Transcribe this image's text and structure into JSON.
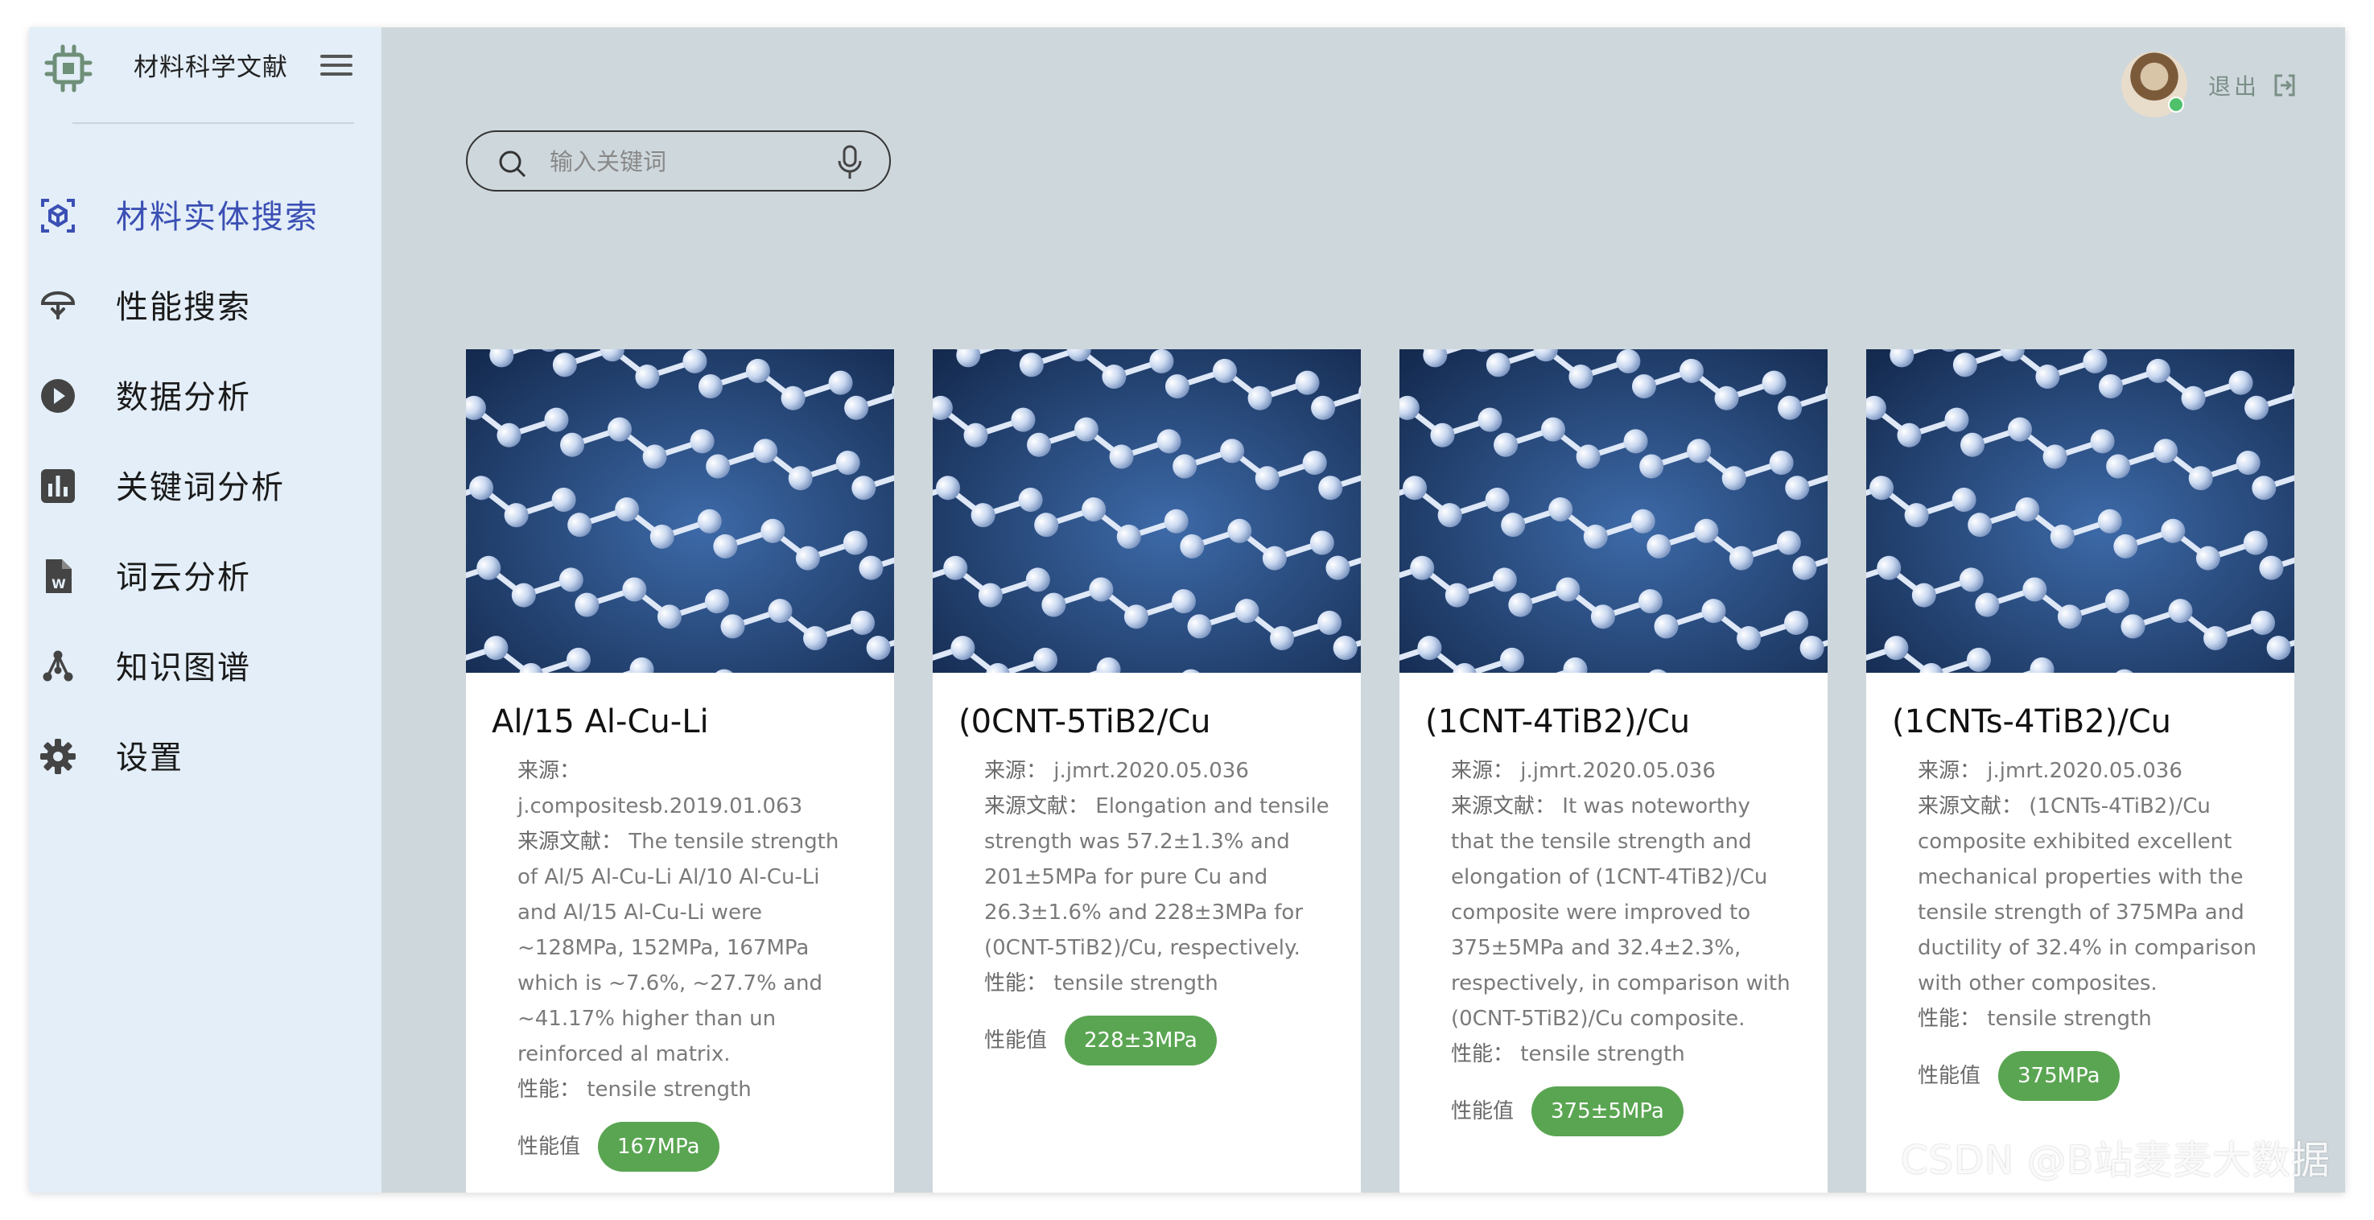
{
  "app": {
    "title": "材料科学文献"
  },
  "nav": {
    "items": [
      {
        "label": "材料实体搜索",
        "icon": "entity-search-icon",
        "active": true
      },
      {
        "label": "性能搜索",
        "icon": "performance-icon",
        "active": false
      },
      {
        "label": "数据分析",
        "icon": "play-circle-icon",
        "active": false
      },
      {
        "label": "关键词分析",
        "icon": "bar-chart-icon",
        "active": false
      },
      {
        "label": "词云分析",
        "icon": "word-file-icon",
        "active": false
      },
      {
        "label": "知识图谱",
        "icon": "graph-icon",
        "active": false
      },
      {
        "label": "设置",
        "icon": "gear-icon",
        "active": false
      }
    ]
  },
  "header": {
    "logout_label": "退出"
  },
  "search": {
    "placeholder": "输入关键词",
    "value": ""
  },
  "cards": [
    {
      "title": "Al/15 Al-Cu-Li",
      "source_key": "来源：",
      "source": "j.compositesb.2019.01.063",
      "doc_key": "来源文献：",
      "doc": "The tensile strength of Al/5 Al-Cu-Li Al/10 Al-Cu-Li and Al/15 Al-Cu-Li were ~128MPa, 152MPa, 167MPa which is ~7.6%, ~27.7% and ~41.17% higher than un reinforced al matrix.",
      "prop_key": "性能：",
      "prop": "tensile strength",
      "value_key": "性能值",
      "value": "167MPa"
    },
    {
      "title": "(0CNT-5TiB2/Cu",
      "source_key": "来源：",
      "source": "j.jmrt.2020.05.036",
      "doc_key": "来源文献：",
      "doc": "Elongation and tensile strength was 57.2±1.3% and 201±5MPa for pure Cu and 26.3±1.6% and 228±3MPa for (0CNT-5TiB2)/Cu, respectively.",
      "prop_key": "性能：",
      "prop": "tensile strength",
      "value_key": "性能值",
      "value": "228±3MPa"
    },
    {
      "title": "(1CNT-4TiB2)/Cu",
      "source_key": "来源：",
      "source": "j.jmrt.2020.05.036",
      "doc_key": "来源文献：",
      "doc": "It was noteworthy that the tensile strength and elongation of (1CNT-4TiB2)/Cu composite were improved to 375±5MPa and 32.4±2.3%, respectively, in comparison with (0CNT-5TiB2)/Cu composite.",
      "prop_key": "性能：",
      "prop": "tensile strength",
      "value_key": "性能值",
      "value": "375±5MPa"
    },
    {
      "title": "(1CNTs-4TiB2)/Cu",
      "source_key": "来源：",
      "source": "j.jmrt.2020.05.036",
      "doc_key": "来源文献：",
      "doc": "(1CNTs-4TiB2)/Cu composite exhibited excellent mechanical properties with the tensile strength of 375MPa and ductility of 32.4% in comparison with other composites.",
      "prop_key": "性能：",
      "prop": "tensile strength",
      "value_key": "性能值",
      "value": "375MPa"
    }
  ],
  "watermark": "CSDN @B站麦麦大数据",
  "colors": {
    "sidebar_bg": "#e3eef8",
    "content_bg": "#ced7dc",
    "active_nav": "#3b4fb4",
    "badge_green": "#5aa552"
  }
}
